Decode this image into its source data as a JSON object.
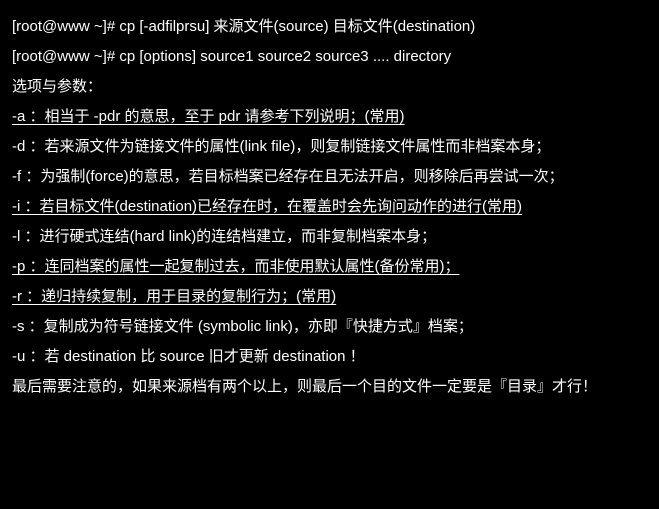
{
  "syntax1": "[root@www ~]# cp [-adfilprsu] 来源文件(source) 目标文件(destination)",
  "syntax2": "[root@www ~]# cp [options] source1 source2 source3 .... directory",
  "options_title": "选项与参数：",
  "opt_a": "-a   ：相当于 -pdr 的意思，至于 pdr 请参考下列说明；(常用)",
  "opt_d": "-d   ：若来源文件为链接文件的属性(link file)，则复制链接文件属性而非档案本身；",
  "opt_f": "-f   ：为强制(force)的意思，若目标档案已经存在且无法开启，则移除后再尝试一次；",
  "opt_i": "-i   ：若目标文件(destination)已经存在时，在覆盖时会先询问动作的进行(常用)",
  "opt_l": "-l   ：进行硬式连结(hard link)的连结档建立，而非复制档案本身；",
  "opt_p": "-p   ：连同档案的属性一起复制过去，而非使用默认属性(备份常用)；",
  "opt_r": "-r   ：递归持续复制，用于目录的复制行为；(常用)",
  "opt_s": "-s   ：复制成为符号链接文件 (symbolic link)，亦即『快捷方式』档案；",
  "opt_u": "-u   ：若 destination 比 source 旧才更新 destination ！",
  "footer": "最后需要注意的，如果来源档有两个以上，则最后一个目的文件一定要是『目录』才行！"
}
